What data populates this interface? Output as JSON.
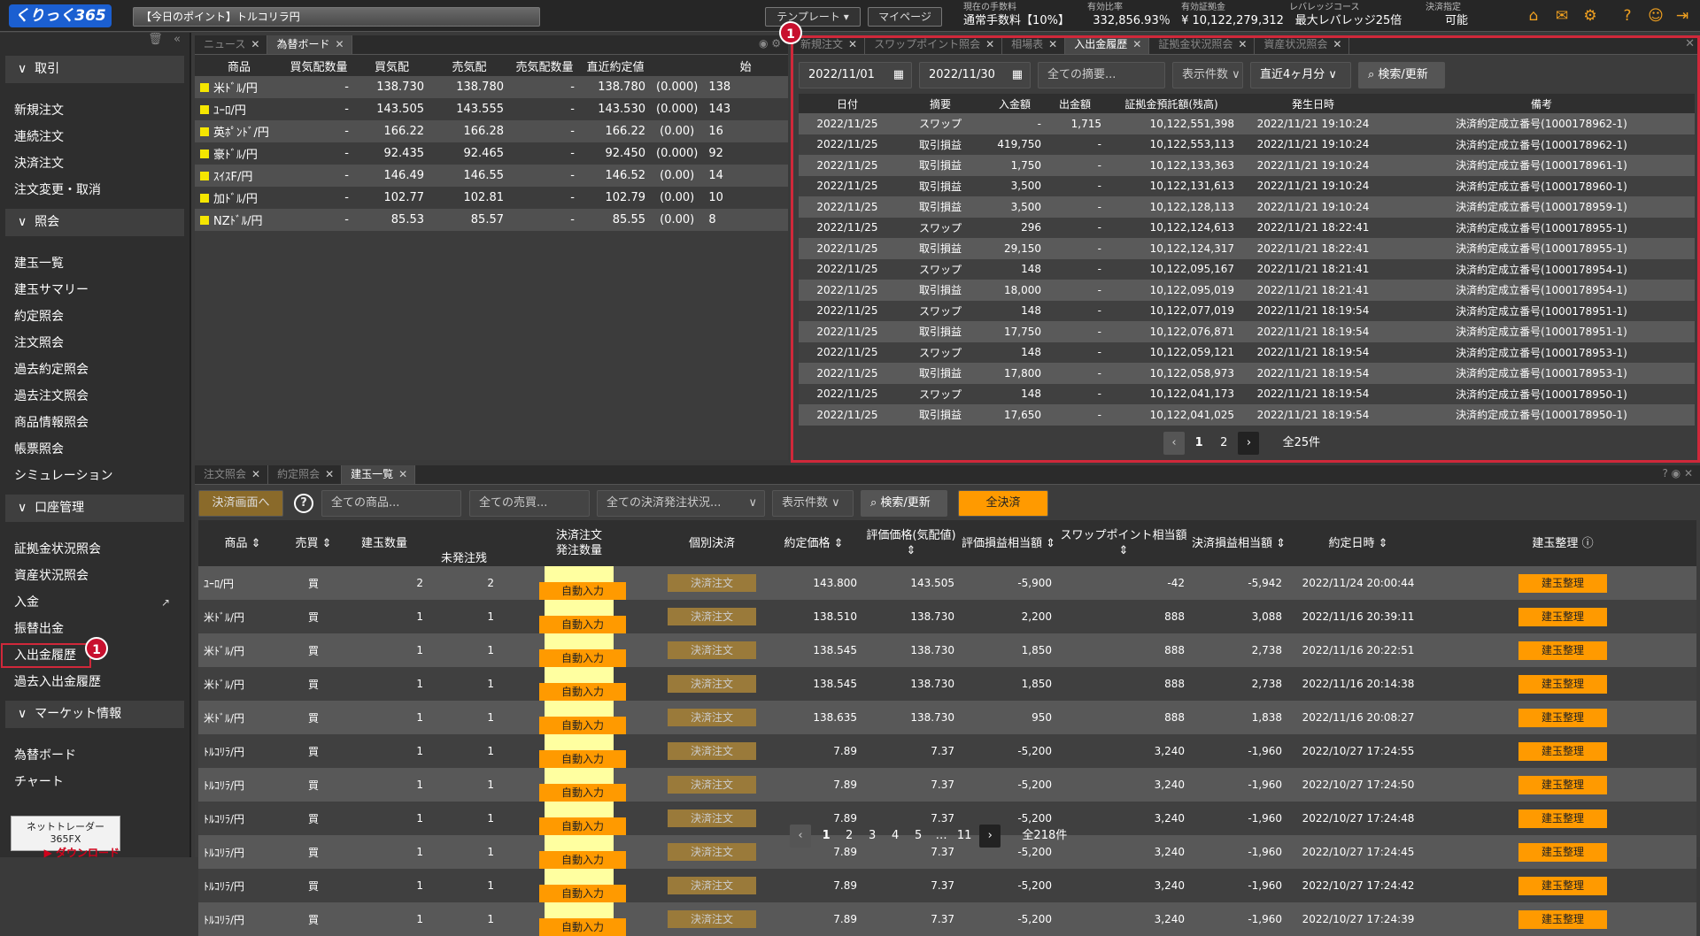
{
  "header": {
    "logo": "くりっく365",
    "ticker": "【今日のポイント】トルコリラ円",
    "template_btn": "テンプレート",
    "mypage_btn": "マイページ",
    "stats": [
      {
        "label": "現在の手数料",
        "value": "通常手数料【10%】"
      },
      {
        "label": "有効比率",
        "value": "332,856.93％"
      },
      {
        "label": "有効証拠金",
        "value": "¥ 10,122,279,312"
      },
      {
        "label": "レバレッジコース",
        "value": "最大レバレッジ25倍"
      },
      {
        "label": "決済指定",
        "value": "可能"
      }
    ]
  },
  "sidebar": {
    "sections": [
      {
        "title": "取引",
        "items": [
          "新規注文",
          "連続注文",
          "決済注文",
          "注文変更・取消"
        ]
      },
      {
        "title": "照会",
        "items": [
          "建玉一覧",
          "建玉サマリー",
          "約定照会",
          "注文照会",
          "過去約定照会",
          "過去注文照会",
          "商品情報照会",
          "帳票照会",
          "シミュレーション"
        ]
      },
      {
        "title": "口座管理",
        "items": [
          "証拠金状況照会",
          "資産状況照会",
          "入金",
          "振替出金",
          "入出金履歴",
          "過去入出金履歴"
        ]
      },
      {
        "title": "マーケット情報",
        "items": [
          "為替ボード",
          "チャート"
        ]
      }
    ],
    "download_line1": "ネットトレーダー365FX",
    "download_line2": "ダウンロード",
    "badge": "1"
  },
  "rate_panel": {
    "tabs": [
      "ニュース",
      "為替ボード"
    ],
    "headers": [
      "商品",
      "買気配数量",
      "買気配",
      "売気配",
      "売気配数量",
      "直近約定値",
      "",
      "始"
    ],
    "rows": [
      [
        "米ﾄﾞﾙ/円",
        "-",
        "138.730",
        "138.780",
        "-",
        "138.780",
        "(0.000)",
        "138"
      ],
      [
        "ﾕｰﾛ/円",
        "-",
        "143.505",
        "143.555",
        "-",
        "143.530",
        "(0.000)",
        "143"
      ],
      [
        "英ﾎﾟﾝﾄﾞ/円",
        "-",
        "166.22",
        "166.28",
        "-",
        "166.22",
        "(0.00)",
        "16"
      ],
      [
        "豪ﾄﾞﾙ/円",
        "-",
        "92.435",
        "92.465",
        "-",
        "92.450",
        "(0.000)",
        "92"
      ],
      [
        "ｽｲｽF/円",
        "-",
        "146.49",
        "146.55",
        "-",
        "146.52",
        "(0.00)",
        "14"
      ],
      [
        "加ﾄﾞﾙ/円",
        "-",
        "102.77",
        "102.81",
        "-",
        "102.79",
        "(0.00)",
        "10"
      ],
      [
        "NZﾄﾞﾙ/円",
        "-",
        "85.53",
        "85.57",
        "-",
        "85.55",
        "(0.00)",
        "8"
      ]
    ]
  },
  "history_panel": {
    "tabs": [
      "新規注文",
      "スワップポイント照会",
      "相場表",
      "入出金履歴",
      "証拠金状況照会",
      "資産状況照会"
    ],
    "date_from": "2022/11/01",
    "date_to": "2022/11/30",
    "summary_placeholder": "全ての摘要...",
    "count_label": "表示件数",
    "period": "直近4ヶ月分",
    "search": "検索/更新",
    "headers": [
      "日付",
      "摘要",
      "入金額",
      "出金額",
      "証拠金預託額(残高)",
      "発生日時",
      "備考"
    ],
    "rows": [
      [
        "2022/11/25",
        "スワップ",
        "-",
        "1,715",
        "10,122,551,398",
        "2022/11/21 19:10:24",
        "決済約定成立番号(1000178962-1)"
      ],
      [
        "2022/11/25",
        "取引損益",
        "419,750",
        "-",
        "10,122,553,113",
        "2022/11/21 19:10:24",
        "決済約定成立番号(1000178962-1)"
      ],
      [
        "2022/11/25",
        "取引損益",
        "1,750",
        "-",
        "10,122,133,363",
        "2022/11/21 19:10:24",
        "決済約定成立番号(1000178961-1)"
      ],
      [
        "2022/11/25",
        "取引損益",
        "3,500",
        "-",
        "10,122,131,613",
        "2022/11/21 19:10:24",
        "決済約定成立番号(1000178960-1)"
      ],
      [
        "2022/11/25",
        "取引損益",
        "3,500",
        "-",
        "10,122,128,113",
        "2022/11/21 19:10:24",
        "決済約定成立番号(1000178959-1)"
      ],
      [
        "2022/11/25",
        "スワップ",
        "296",
        "-",
        "10,122,124,613",
        "2022/11/21 18:22:41",
        "決済約定成立番号(1000178955-1)"
      ],
      [
        "2022/11/25",
        "取引損益",
        "29,150",
        "-",
        "10,122,124,317",
        "2022/11/21 18:22:41",
        "決済約定成立番号(1000178955-1)"
      ],
      [
        "2022/11/25",
        "スワップ",
        "148",
        "-",
        "10,122,095,167",
        "2022/11/21 18:21:41",
        "決済約定成立番号(1000178954-1)"
      ],
      [
        "2022/11/25",
        "取引損益",
        "18,000",
        "-",
        "10,122,095,019",
        "2022/11/21 18:21:41",
        "決済約定成立番号(1000178954-1)"
      ],
      [
        "2022/11/25",
        "スワップ",
        "148",
        "-",
        "10,122,077,019",
        "2022/11/21 18:19:54",
        "決済約定成立番号(1000178951-1)"
      ],
      [
        "2022/11/25",
        "取引損益",
        "17,750",
        "-",
        "10,122,076,871",
        "2022/11/21 18:19:54",
        "決済約定成立番号(1000178951-1)"
      ],
      [
        "2022/11/25",
        "スワップ",
        "148",
        "-",
        "10,122,059,121",
        "2022/11/21 18:19:54",
        "決済約定成立番号(1000178953-1)"
      ],
      [
        "2022/11/25",
        "取引損益",
        "17,800",
        "-",
        "10,122,058,973",
        "2022/11/21 18:19:54",
        "決済約定成立番号(1000178953-1)"
      ],
      [
        "2022/11/25",
        "スワップ",
        "148",
        "-",
        "10,122,041,173",
        "2022/11/21 18:19:54",
        "決済約定成立番号(1000178950-1)"
      ],
      [
        "2022/11/25",
        "取引損益",
        "17,650",
        "-",
        "10,122,041,025",
        "2022/11/21 18:19:54",
        "決済約定成立番号(1000178950-1)"
      ]
    ],
    "pages": [
      "1",
      "2"
    ],
    "total": "全25件",
    "badge": "1"
  },
  "position_panel": {
    "tabs": [
      "注文照会",
      "約定照会",
      "建玉一覧"
    ],
    "settle_screen_btn": "決済画面へ",
    "product_placeholder": "全ての商品...",
    "side_placeholder": "全ての売買...",
    "status_placeholder": "全ての決済発注状況...",
    "count_label": "表示件数",
    "search": "検索/更新",
    "all_settle": "全決済",
    "headers": [
      "商品",
      "売買",
      "建玉数量",
      "未発注残",
      "決済注文",
      "発注数量",
      "個別決済",
      "約定価格",
      "評価価格(気配値)",
      "評価損益相当額",
      "スワップポイント相当額",
      "決済損益相当額",
      "約定日時",
      "建玉整理"
    ],
    "auto_input": "自動入力",
    "settle_order": "決済注文",
    "organize": "建玉整理",
    "rows": [
      [
        "ﾕｰﾛ/円",
        "買",
        "2",
        "2",
        "143.800",
        "143.505",
        "-5,900",
        "-42",
        "-5,942",
        "2022/11/24 20:00:44"
      ],
      [
        "米ﾄﾞﾙ/円",
        "買",
        "1",
        "1",
        "138.510",
        "138.730",
        "2,200",
        "888",
        "3,088",
        "2022/11/16 20:39:11"
      ],
      [
        "米ﾄﾞﾙ/円",
        "買",
        "1",
        "1",
        "138.545",
        "138.730",
        "1,850",
        "888",
        "2,738",
        "2022/11/16 20:22:51"
      ],
      [
        "米ﾄﾞﾙ/円",
        "買",
        "1",
        "1",
        "138.545",
        "138.730",
        "1,850",
        "888",
        "2,738",
        "2022/11/16 20:14:38"
      ],
      [
        "米ﾄﾞﾙ/円",
        "買",
        "1",
        "1",
        "138.635",
        "138.730",
        "950",
        "888",
        "1,838",
        "2022/11/16 20:08:27"
      ],
      [
        "ﾄﾙｺﾘﾗ/円",
        "買",
        "1",
        "1",
        "7.89",
        "7.37",
        "-5,200",
        "3,240",
        "-1,960",
        "2022/10/27 17:24:55"
      ],
      [
        "ﾄﾙｺﾘﾗ/円",
        "買",
        "1",
        "1",
        "7.89",
        "7.37",
        "-5,200",
        "3,240",
        "-1,960",
        "2022/10/27 17:24:50"
      ],
      [
        "ﾄﾙｺﾘﾗ/円",
        "買",
        "1",
        "1",
        "7.89",
        "7.37",
        "-5,200",
        "3,240",
        "-1,960",
        "2022/10/27 17:24:48"
      ],
      [
        "ﾄﾙｺﾘﾗ/円",
        "買",
        "1",
        "1",
        "7.89",
        "7.37",
        "-5,200",
        "3,240",
        "-1,960",
        "2022/10/27 17:24:45"
      ],
      [
        "ﾄﾙｺﾘﾗ/円",
        "買",
        "1",
        "1",
        "7.89",
        "7.37",
        "-5,200",
        "3,240",
        "-1,960",
        "2022/10/27 17:24:42"
      ],
      [
        "ﾄﾙｺﾘﾗ/円",
        "買",
        "1",
        "1",
        "7.89",
        "7.37",
        "-5,200",
        "3,240",
        "-1,960",
        "2022/10/27 17:24:39"
      ]
    ],
    "pages": [
      "1",
      "2",
      "3",
      "4",
      "5",
      "…",
      "11"
    ],
    "total": "全218件"
  },
  "colors": {
    "accent": "#ff9a00",
    "highlight": "#d0283a",
    "buy": "#19c4a0",
    "sell": "#ff4a5f",
    "positive": "#4fb0f0"
  }
}
